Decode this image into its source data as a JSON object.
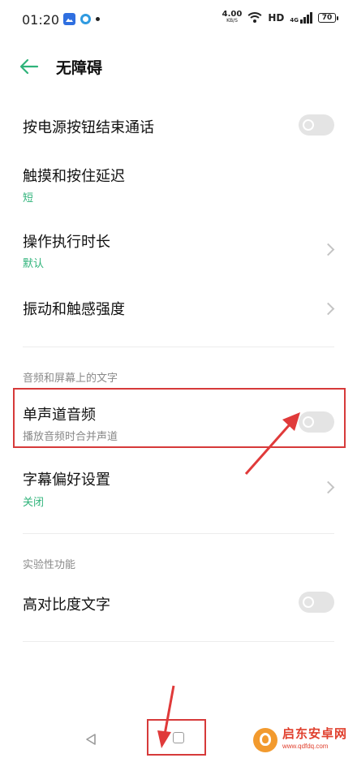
{
  "status_bar": {
    "time": "01:20",
    "net_speed_value": "4.00",
    "net_speed_unit": "KB/S",
    "hd": "HD",
    "signal_label": "4G",
    "battery": "70"
  },
  "header": {
    "title": "无障碍",
    "back_icon": "back-arrow-icon"
  },
  "items": {
    "power_end_call": {
      "title": "按电源按钮结束通话"
    },
    "touch_hold_delay": {
      "title": "触摸和按住延迟",
      "value": "短"
    },
    "action_duration": {
      "title": "操作执行时长",
      "value": "默认"
    },
    "vibration": {
      "title": "振动和触感强度"
    },
    "mono_audio": {
      "title": "单声道音频",
      "subtitle": "播放音频时合并声道"
    },
    "caption": {
      "title": "字幕偏好设置",
      "value": "关闭"
    },
    "high_contrast": {
      "title": "高对比度文字"
    }
  },
  "sections": {
    "audio_text": "音频和屏幕上的文字",
    "experimental": "实验性功能"
  },
  "watermark": {
    "name": "启东安卓网",
    "url": "www.qdfdq.com"
  },
  "colors": {
    "accent": "#2fb37a",
    "annotation": "#d63a3a"
  }
}
